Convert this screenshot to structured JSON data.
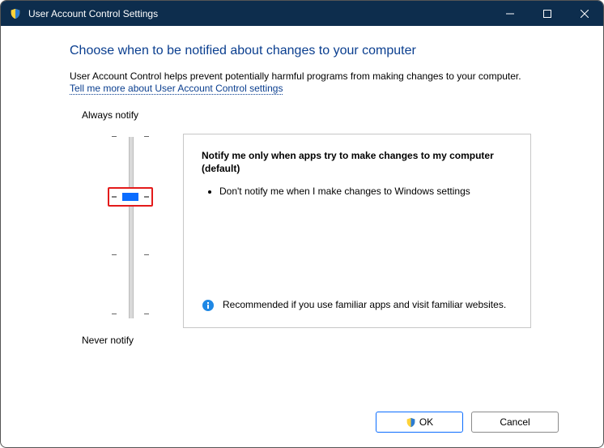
{
  "titlebar": {
    "title": "User Account Control Settings"
  },
  "heading": "Choose when to be notified about changes to your computer",
  "description": "User Account Control helps prevent potentially harmful programs from making changes to your computer.",
  "link_text": "Tell me more about User Account Control settings",
  "slider": {
    "top_label": "Always notify",
    "bottom_label": "Never notify",
    "levels": 4,
    "selected_index": 1
  },
  "panel": {
    "title": "Notify me only when apps try to make changes to my computer (default)",
    "bullets": [
      "Don't notify me when I make changes to Windows settings"
    ],
    "recommendation": "Recommended if you use familiar apps and visit familiar websites."
  },
  "buttons": {
    "ok": "OK",
    "cancel": "Cancel"
  }
}
